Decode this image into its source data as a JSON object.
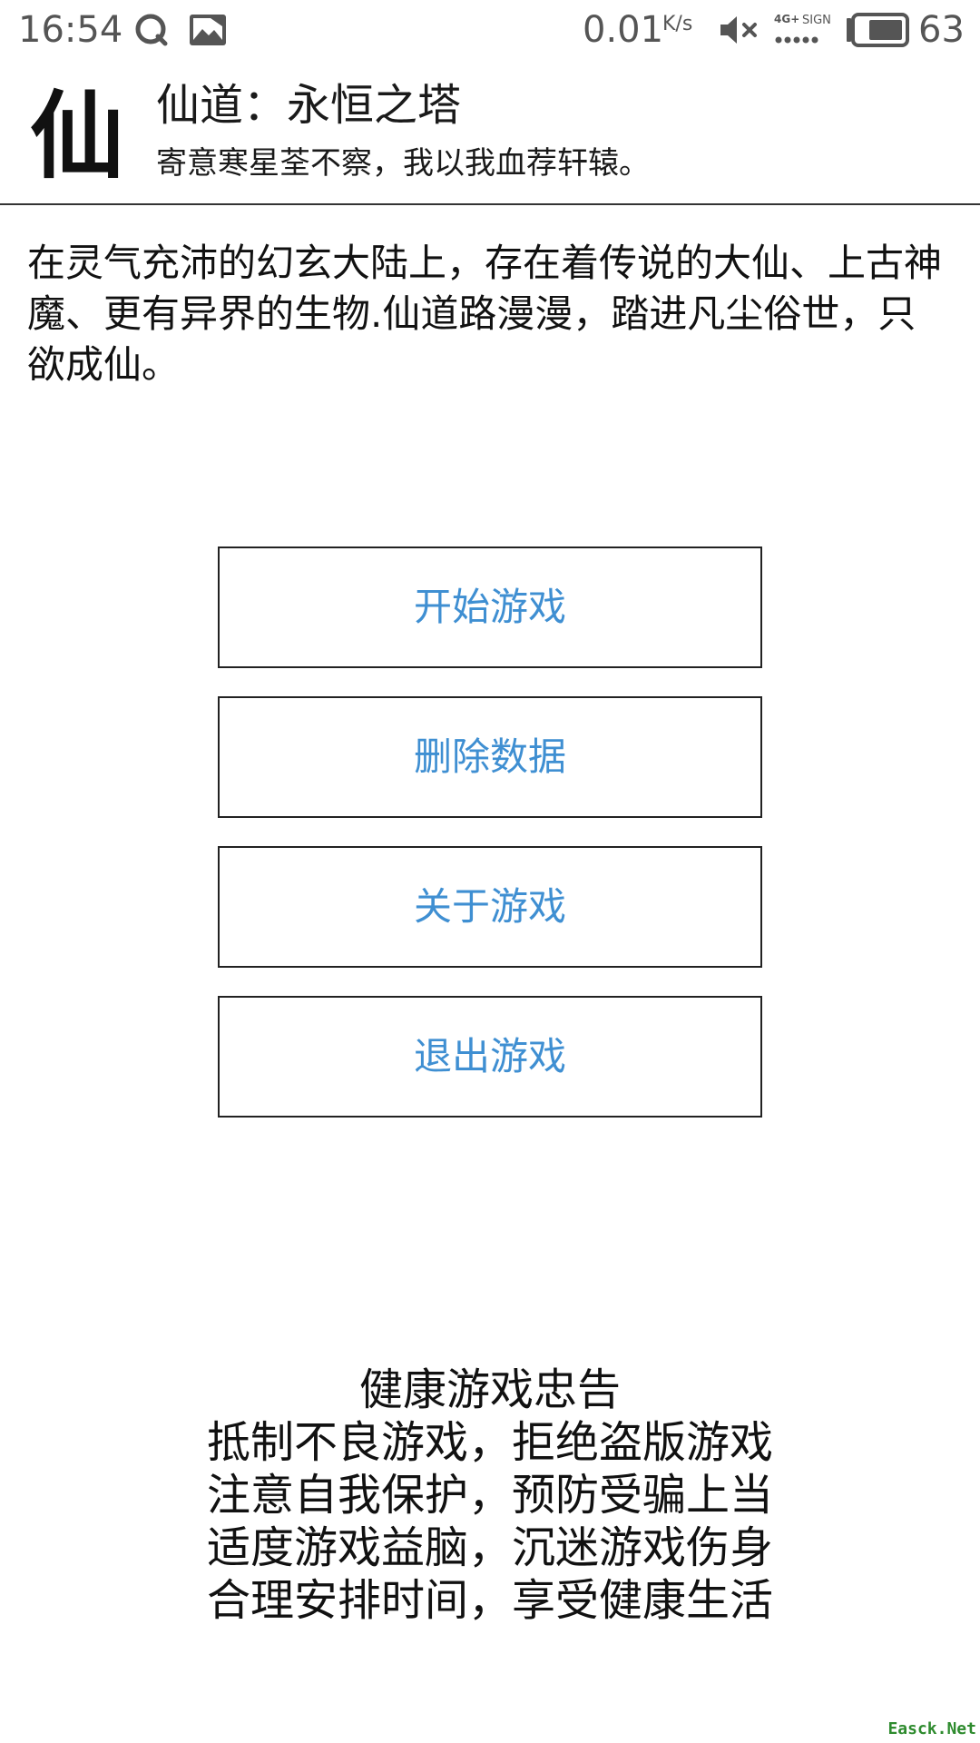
{
  "status_bar": {
    "time": "16:54",
    "net_speed": "0.01",
    "net_speed_unit": "K/s",
    "network_type": "4G+",
    "signal_label": "SIGN",
    "battery_percent": "63",
    "icons": [
      "qq-icon",
      "gallery-icon",
      "mute-icon",
      "signal-icon",
      "battery-icon"
    ]
  },
  "header": {
    "logo_char": "仙",
    "title": "仙道：永恒之塔",
    "subtitle": "寄意寒星荃不察，我以我血荐轩辕。"
  },
  "intro": {
    "text": "在灵气充沛的幻玄大陆上，存在着传说的大仙、上古神魔、更有异界的生物.仙道路漫漫，踏进凡尘俗世，只欲成仙。"
  },
  "menu": {
    "start_label": "开始游戏",
    "delete_label": "删除数据",
    "about_label": "关于游戏",
    "exit_label": "退出游戏"
  },
  "notice": {
    "lines": [
      "健康游戏忠告",
      "抵制不良游戏，拒绝盗版游戏",
      "注意自我保护，预防受骗上当",
      "适度游戏益脑，沉迷游戏伤身",
      "合理安排时间，享受健康生活"
    ]
  },
  "watermark": "Easck.Net",
  "colors": {
    "button_text": "#3f8fd2",
    "button_border": "#222222",
    "status_text": "#555555",
    "watermark": "#2e8b2e"
  }
}
